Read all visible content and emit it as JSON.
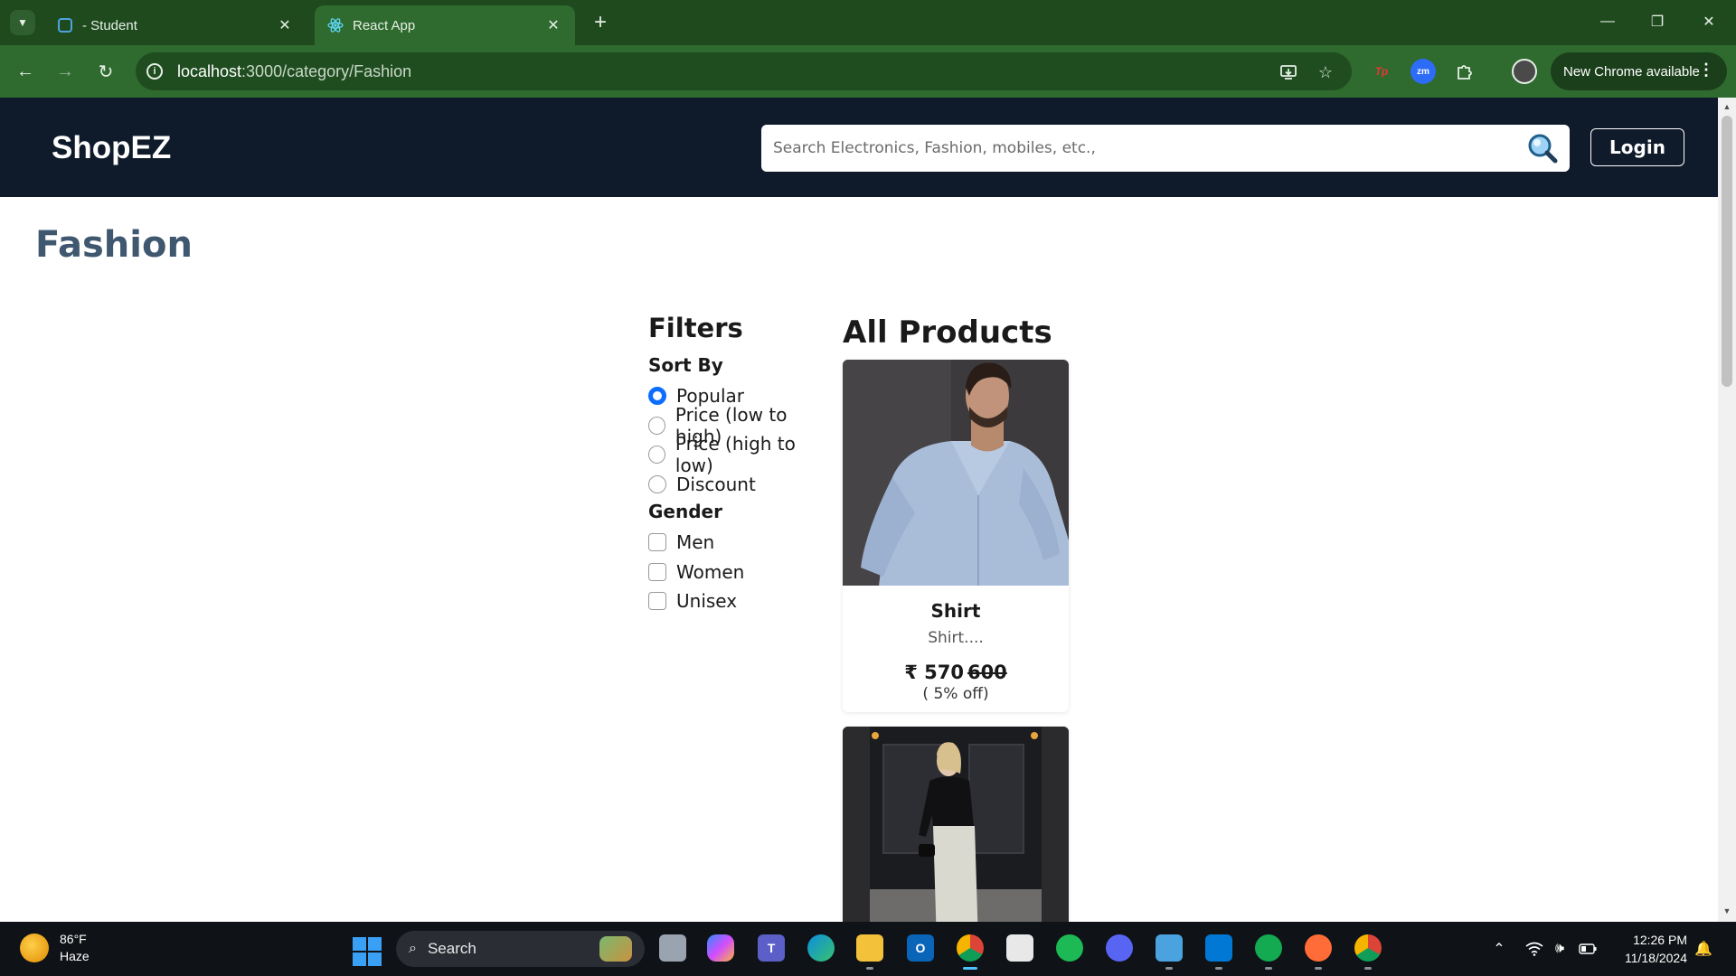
{
  "browser": {
    "tabs": [
      {
        "title": "- Student",
        "active": false
      },
      {
        "title": "React App",
        "active": true
      }
    ],
    "url": {
      "host": "localhost",
      "path": ":3000/category/Fashion"
    },
    "update_label": "New Chrome available"
  },
  "site": {
    "brand": "ShopEZ",
    "search_placeholder": "Search Electronics, Fashion, mobiles, etc.,",
    "login_label": "Login"
  },
  "category": {
    "title": "Fashion"
  },
  "filters": {
    "title": "Filters",
    "sort_heading": "Sort By",
    "sort_options": [
      {
        "label": "Popular",
        "checked": true
      },
      {
        "label": "Price (low to high)",
        "checked": false
      },
      {
        "label": "Price (high to low)",
        "checked": false
      },
      {
        "label": "Discount",
        "checked": false
      }
    ],
    "gender_heading": "Gender",
    "gender_options": [
      {
        "label": "Men",
        "checked": false
      },
      {
        "label": "Women",
        "checked": false
      },
      {
        "label": "Unisex",
        "checked": false
      }
    ]
  },
  "products": {
    "title": "All Products",
    "items": [
      {
        "name": "Shirt",
        "description": "Shirt....",
        "price": "₹ 570",
        "old_price": "600",
        "discount": "( 5% off)"
      }
    ]
  },
  "taskbar": {
    "weather": {
      "temp": "86°F",
      "condition": "Haze"
    },
    "search_label": "Search",
    "time": "12:26 PM",
    "date": "11/18/2024"
  },
  "colors": {
    "header_bg": "#0f1a2b",
    "category_title": "#3f5870",
    "radio_accent": "#0d6efd",
    "browser_frame": "#1e4a1e"
  }
}
